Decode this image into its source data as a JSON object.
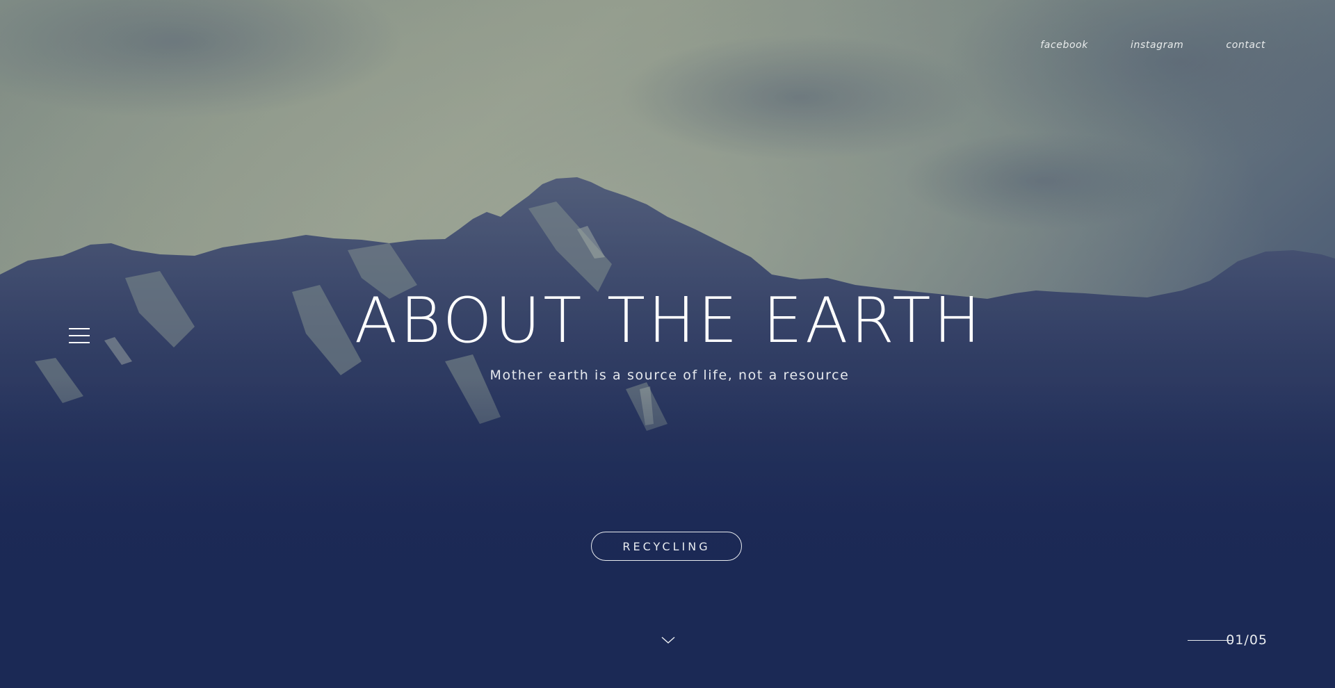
{
  "nav": {
    "links": [
      {
        "label": "facebook"
      },
      {
        "label": "instagram"
      },
      {
        "label": "contact"
      }
    ]
  },
  "hero": {
    "title": "ABOUT THE EARTH",
    "subtitle": "Mother earth is a source of life, not a resource",
    "cta_label": "RECYCLING"
  },
  "slider": {
    "current": "01",
    "separator": "/",
    "total": "05"
  },
  "icons": {
    "menu": "hamburger-menu-icon",
    "scroll": "chevron-down-icon"
  },
  "colors": {
    "sky_light": "#a7af98",
    "sky_mid": "#6f7f86",
    "navy": "#1c2a56",
    "text": "#ffffff"
  }
}
